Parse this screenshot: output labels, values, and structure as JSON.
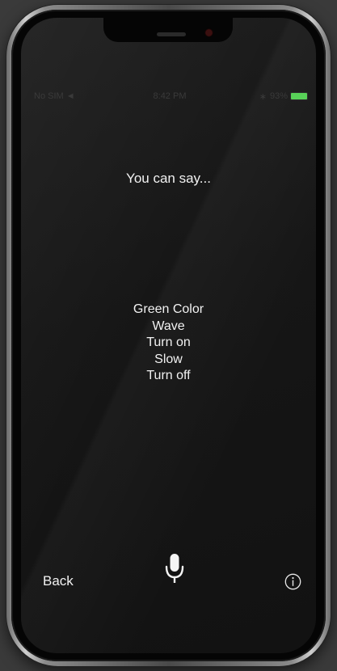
{
  "status_bar": {
    "carrier": "No SIM",
    "time": "8:42 PM",
    "battery_text": "93%",
    "battery_color": "#58d158"
  },
  "prompt": {
    "title": "You can say..."
  },
  "commands": [
    "Green Color",
    "Wave",
    "Turn on",
    "Slow",
    "Turn off"
  ],
  "bottom_bar": {
    "back_label": "Back",
    "mic_icon": "microphone-icon",
    "info_icon": "info-icon"
  }
}
